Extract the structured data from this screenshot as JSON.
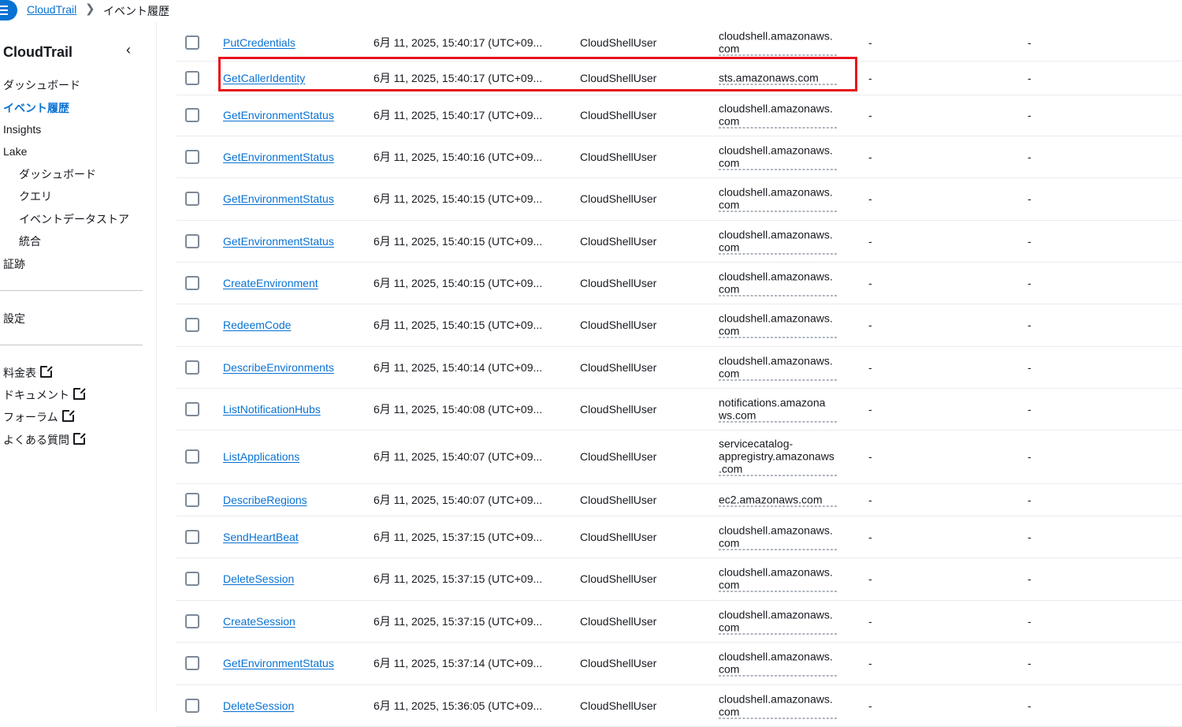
{
  "breadcrumb": {
    "link": "CloudTrail",
    "current": "イベント履歴"
  },
  "sidebar": {
    "title": "CloudTrail",
    "items": [
      "ダッシュボード",
      "イベント履歴",
      "Insights",
      "Lake"
    ],
    "lake_items": [
      "ダッシュボード",
      "クエリ",
      "イベントデータストア",
      "統合"
    ],
    "evidence": "証跡",
    "settings": "設定",
    "external_links": [
      "料金表",
      "ドキュメント",
      "フォーラム",
      "よくある質問"
    ]
  },
  "events": [
    {
      "name": "PutCredentials",
      "time": "6月 11, 2025, 15:40:17 (UTC+09...",
      "user": "CloudShellUser",
      "source": [
        "cloudshell.amazonaws.",
        "com"
      ],
      "a": "-",
      "b": "-"
    },
    {
      "name": "GetCallerIdentity",
      "time": "6月 11, 2025, 15:40:17 (UTC+09...",
      "user": "CloudShellUser",
      "source": [
        "sts.amazonaws.com"
      ],
      "a": "-",
      "b": "-"
    },
    {
      "name": "GetEnvironmentStatus",
      "time": "6月 11, 2025, 15:40:17 (UTC+09...",
      "user": "CloudShellUser",
      "source": [
        "cloudshell.amazonaws.",
        "com"
      ],
      "a": "-",
      "b": "-"
    },
    {
      "name": "GetEnvironmentStatus",
      "time": "6月 11, 2025, 15:40:16 (UTC+09...",
      "user": "CloudShellUser",
      "source": [
        "cloudshell.amazonaws.",
        "com"
      ],
      "a": "-",
      "b": "-"
    },
    {
      "name": "GetEnvironmentStatus",
      "time": "6月 11, 2025, 15:40:15 (UTC+09...",
      "user": "CloudShellUser",
      "source": [
        "cloudshell.amazonaws.",
        "com"
      ],
      "a": "-",
      "b": "-"
    },
    {
      "name": "GetEnvironmentStatus",
      "time": "6月 11, 2025, 15:40:15 (UTC+09...",
      "user": "CloudShellUser",
      "source": [
        "cloudshell.amazonaws.",
        "com"
      ],
      "a": "-",
      "b": "-"
    },
    {
      "name": "CreateEnvironment",
      "time": "6月 11, 2025, 15:40:15 (UTC+09...",
      "user": "CloudShellUser",
      "source": [
        "cloudshell.amazonaws.",
        "com"
      ],
      "a": "-",
      "b": "-"
    },
    {
      "name": "RedeemCode",
      "time": "6月 11, 2025, 15:40:15 (UTC+09...",
      "user": "CloudShellUser",
      "source": [
        "cloudshell.amazonaws.",
        "com"
      ],
      "a": "-",
      "b": "-"
    },
    {
      "name": "DescribeEnvironments",
      "time": "6月 11, 2025, 15:40:14 (UTC+09...",
      "user": "CloudShellUser",
      "source": [
        "cloudshell.amazonaws.",
        "com"
      ],
      "a": "-",
      "b": "-"
    },
    {
      "name": "ListNotificationHubs",
      "time": "6月 11, 2025, 15:40:08 (UTC+09...",
      "user": "CloudShellUser",
      "source": [
        "notifications.amazona",
        "ws.com"
      ],
      "a": "-",
      "b": "-"
    },
    {
      "name": "ListApplications",
      "time": "6月 11, 2025, 15:40:07 (UTC+09...",
      "user": "CloudShellUser",
      "source": [
        "servicecatalog-",
        "appregistry.amazonaws",
        ".com"
      ],
      "a": "-",
      "b": "-"
    },
    {
      "name": "DescribeRegions",
      "time": "6月 11, 2025, 15:40:07 (UTC+09...",
      "user": "CloudShellUser",
      "source": [
        "ec2.amazonaws.com"
      ],
      "a": "-",
      "b": "-"
    },
    {
      "name": "SendHeartBeat",
      "time": "6月 11, 2025, 15:37:15 (UTC+09...",
      "user": "CloudShellUser",
      "source": [
        "cloudshell.amazonaws.",
        "com"
      ],
      "a": "-",
      "b": "-"
    },
    {
      "name": "DeleteSession",
      "time": "6月 11, 2025, 15:37:15 (UTC+09...",
      "user": "CloudShellUser",
      "source": [
        "cloudshell.amazonaws.",
        "com"
      ],
      "a": "-",
      "b": "-"
    },
    {
      "name": "CreateSession",
      "time": "6月 11, 2025, 15:37:15 (UTC+09...",
      "user": "CloudShellUser",
      "source": [
        "cloudshell.amazonaws.",
        "com"
      ],
      "a": "-",
      "b": "-"
    },
    {
      "name": "GetEnvironmentStatus",
      "time": "6月 11, 2025, 15:37:14 (UTC+09...",
      "user": "CloudShellUser",
      "source": [
        "cloudshell.amazonaws.",
        "com"
      ],
      "a": "-",
      "b": "-"
    },
    {
      "name": "DeleteSession",
      "time": "6月 11, 2025, 15:36:05 (UTC+09...",
      "user": "CloudShellUser",
      "source": [
        "cloudshell.amazonaws.",
        "com"
      ],
      "a": "-",
      "b": "-"
    }
  ]
}
